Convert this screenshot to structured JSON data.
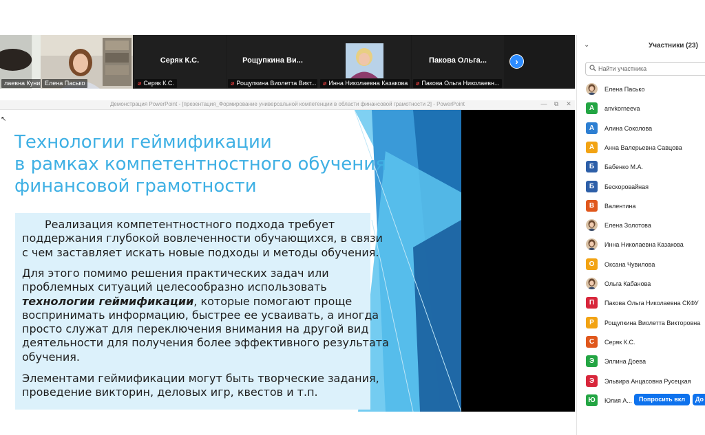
{
  "video_strip": {
    "tiles": [
      {
        "name_label": "лаевна Куни...",
        "muted": false
      },
      {
        "name_label": "Елена Пасько",
        "muted": false
      },
      {
        "display_name": "Серяк К.С.",
        "name_label": "Серяк К.С.",
        "muted": true
      },
      {
        "display_name": "Рощупкина Ви...",
        "name_label": "Рощупкина Виолетта Викт...",
        "muted": true
      },
      {
        "name_label": "Инна Николаевна Казакова",
        "muted": true
      },
      {
        "display_name": "Пакова Ольга...",
        "name_label": "Пакова Ольга Николаевн...",
        "muted": true
      }
    ],
    "next_icon": "chevron-right-icon"
  },
  "powerpoint": {
    "window_title": "Демонстрация PowerPoint - [презентация_Формирование универсальной компетенции в области финансовой грамотности 2] - PowerPoint",
    "minimize": "—",
    "restore": "⧉",
    "close": "✕"
  },
  "slide": {
    "title_lines": [
      "Технологии геймификации",
      "в рамках компетентностного обучения",
      "финансовой грамотности"
    ],
    "para1_lines": [
      "Реализация компетентностного подхода требует",
      "поддержания глубокой вовлеченности обучающихся, в связи",
      "с чем заставляет искать новые подходы и методы обучения."
    ],
    "para2_line1": "Для этого помимо решения практических задач или",
    "para2_line2": "проблемных ситуаций целесообразно использовать",
    "para2_emphasis": "технологии геймификации",
    "para2_line3_rest": ", которые помогают проще",
    "para2_rest_lines": [
      "воспринимать информацию, быстрее ее усваивать, а иногда",
      "просто служат для переключения внимания на другой вид",
      "деятельности для получения более эффективного результата",
      "обучения."
    ],
    "para3_lines": [
      "Элементами геймификации могут быть творческие задания,",
      "проведение викторин, деловых игр, квестов и т.п."
    ],
    "colors": {
      "title": "#3fb0e4",
      "box": "#dcf1fb",
      "accent_dark": "#1e72b4",
      "accent_light": "#5cc3ee"
    }
  },
  "panel": {
    "collapse_icon": "chevron-down-icon",
    "title": "Участники (23)",
    "search_placeholder": "Найти участника",
    "participants": [
      {
        "initial": "",
        "photo": true,
        "name": "Елена Пасько"
      },
      {
        "initial": "A",
        "color": "#23a543",
        "name": "anvkorneeva"
      },
      {
        "initial": "А",
        "color": "#2d7fd2",
        "name": "Алина Соколова"
      },
      {
        "initial": "А",
        "color": "#f2a313",
        "name": "Анна Валерьевна Савцова"
      },
      {
        "initial": "Б",
        "color": "#2d5fa8",
        "name": "Бабенко М.А."
      },
      {
        "initial": "Б",
        "color": "#2d5fa8",
        "name": "Бескоровайная"
      },
      {
        "initial": "В",
        "color": "#e0571c",
        "name": "Валентина"
      },
      {
        "initial": "",
        "photo": true,
        "name": "Елена Золотова"
      },
      {
        "initial": "",
        "photo": true,
        "name": "Инна Николаевна Казакова"
      },
      {
        "initial": "О",
        "color": "#f2a313",
        "name": "Оксана Чувилова"
      },
      {
        "initial": "",
        "photo": true,
        "name": "Ольга Кабанова"
      },
      {
        "initial": "П",
        "color": "#d8263b",
        "name": "Пакова Ольга Николаевна СКФУ"
      },
      {
        "initial": "Р",
        "color": "#f2a313",
        "name": "Рощупкина Виолетта Викторовна"
      },
      {
        "initial": "С",
        "color": "#e0571c",
        "name": "Серяк К.С."
      },
      {
        "initial": "Э",
        "color": "#23a543",
        "name": "Эллина Доева"
      },
      {
        "initial": "Э",
        "color": "#d8263b",
        "name": "Эльвира Анцасовна Русецкая"
      },
      {
        "initial": "Ю",
        "color": "#23a543",
        "name": "Юлия А..."
      }
    ],
    "ask_unmute_label": "Попросить вкл",
    "more_label": "До"
  }
}
